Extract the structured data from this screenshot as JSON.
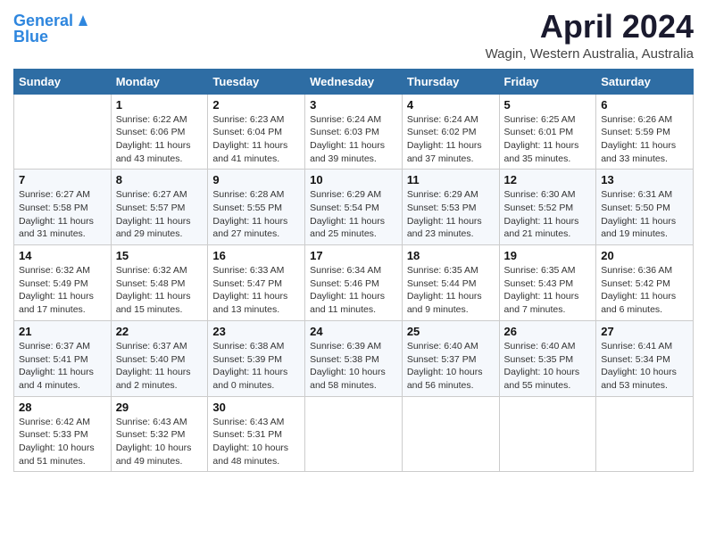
{
  "header": {
    "logo_line1": "General",
    "logo_line2": "Blue",
    "month": "April 2024",
    "location": "Wagin, Western Australia, Australia"
  },
  "days_of_week": [
    "Sunday",
    "Monday",
    "Tuesday",
    "Wednesday",
    "Thursday",
    "Friday",
    "Saturday"
  ],
  "weeks": [
    [
      {
        "day": "",
        "info": ""
      },
      {
        "day": "1",
        "info": "Sunrise: 6:22 AM\nSunset: 6:06 PM\nDaylight: 11 hours\nand 43 minutes."
      },
      {
        "day": "2",
        "info": "Sunrise: 6:23 AM\nSunset: 6:04 PM\nDaylight: 11 hours\nand 41 minutes."
      },
      {
        "day": "3",
        "info": "Sunrise: 6:24 AM\nSunset: 6:03 PM\nDaylight: 11 hours\nand 39 minutes."
      },
      {
        "day": "4",
        "info": "Sunrise: 6:24 AM\nSunset: 6:02 PM\nDaylight: 11 hours\nand 37 minutes."
      },
      {
        "day": "5",
        "info": "Sunrise: 6:25 AM\nSunset: 6:01 PM\nDaylight: 11 hours\nand 35 minutes."
      },
      {
        "day": "6",
        "info": "Sunrise: 6:26 AM\nSunset: 5:59 PM\nDaylight: 11 hours\nand 33 minutes."
      }
    ],
    [
      {
        "day": "7",
        "info": "Sunrise: 6:27 AM\nSunset: 5:58 PM\nDaylight: 11 hours\nand 31 minutes."
      },
      {
        "day": "8",
        "info": "Sunrise: 6:27 AM\nSunset: 5:57 PM\nDaylight: 11 hours\nand 29 minutes."
      },
      {
        "day": "9",
        "info": "Sunrise: 6:28 AM\nSunset: 5:55 PM\nDaylight: 11 hours\nand 27 minutes."
      },
      {
        "day": "10",
        "info": "Sunrise: 6:29 AM\nSunset: 5:54 PM\nDaylight: 11 hours\nand 25 minutes."
      },
      {
        "day": "11",
        "info": "Sunrise: 6:29 AM\nSunset: 5:53 PM\nDaylight: 11 hours\nand 23 minutes."
      },
      {
        "day": "12",
        "info": "Sunrise: 6:30 AM\nSunset: 5:52 PM\nDaylight: 11 hours\nand 21 minutes."
      },
      {
        "day": "13",
        "info": "Sunrise: 6:31 AM\nSunset: 5:50 PM\nDaylight: 11 hours\nand 19 minutes."
      }
    ],
    [
      {
        "day": "14",
        "info": "Sunrise: 6:32 AM\nSunset: 5:49 PM\nDaylight: 11 hours\nand 17 minutes."
      },
      {
        "day": "15",
        "info": "Sunrise: 6:32 AM\nSunset: 5:48 PM\nDaylight: 11 hours\nand 15 minutes."
      },
      {
        "day": "16",
        "info": "Sunrise: 6:33 AM\nSunset: 5:47 PM\nDaylight: 11 hours\nand 13 minutes."
      },
      {
        "day": "17",
        "info": "Sunrise: 6:34 AM\nSunset: 5:46 PM\nDaylight: 11 hours\nand 11 minutes."
      },
      {
        "day": "18",
        "info": "Sunrise: 6:35 AM\nSunset: 5:44 PM\nDaylight: 11 hours\nand 9 minutes."
      },
      {
        "day": "19",
        "info": "Sunrise: 6:35 AM\nSunset: 5:43 PM\nDaylight: 11 hours\nand 7 minutes."
      },
      {
        "day": "20",
        "info": "Sunrise: 6:36 AM\nSunset: 5:42 PM\nDaylight: 11 hours\nand 6 minutes."
      }
    ],
    [
      {
        "day": "21",
        "info": "Sunrise: 6:37 AM\nSunset: 5:41 PM\nDaylight: 11 hours\nand 4 minutes."
      },
      {
        "day": "22",
        "info": "Sunrise: 6:37 AM\nSunset: 5:40 PM\nDaylight: 11 hours\nand 2 minutes."
      },
      {
        "day": "23",
        "info": "Sunrise: 6:38 AM\nSunset: 5:39 PM\nDaylight: 11 hours\nand 0 minutes."
      },
      {
        "day": "24",
        "info": "Sunrise: 6:39 AM\nSunset: 5:38 PM\nDaylight: 10 hours\nand 58 minutes."
      },
      {
        "day": "25",
        "info": "Sunrise: 6:40 AM\nSunset: 5:37 PM\nDaylight: 10 hours\nand 56 minutes."
      },
      {
        "day": "26",
        "info": "Sunrise: 6:40 AM\nSunset: 5:35 PM\nDaylight: 10 hours\nand 55 minutes."
      },
      {
        "day": "27",
        "info": "Sunrise: 6:41 AM\nSunset: 5:34 PM\nDaylight: 10 hours\nand 53 minutes."
      }
    ],
    [
      {
        "day": "28",
        "info": "Sunrise: 6:42 AM\nSunset: 5:33 PM\nDaylight: 10 hours\nand 51 minutes."
      },
      {
        "day": "29",
        "info": "Sunrise: 6:43 AM\nSunset: 5:32 PM\nDaylight: 10 hours\nand 49 minutes."
      },
      {
        "day": "30",
        "info": "Sunrise: 6:43 AM\nSunset: 5:31 PM\nDaylight: 10 hours\nand 48 minutes."
      },
      {
        "day": "",
        "info": ""
      },
      {
        "day": "",
        "info": ""
      },
      {
        "day": "",
        "info": ""
      },
      {
        "day": "",
        "info": ""
      }
    ]
  ]
}
